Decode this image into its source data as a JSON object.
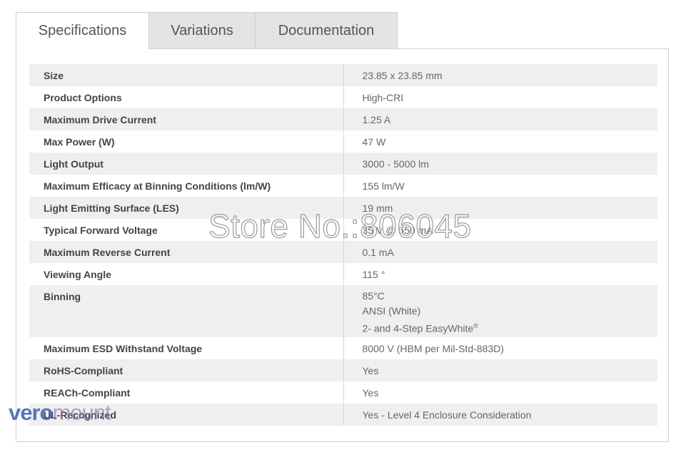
{
  "tabs": [
    {
      "label": "Specifications",
      "active": true
    },
    {
      "label": "Variations",
      "active": false
    },
    {
      "label": "Documentation",
      "active": false
    }
  ],
  "specs": [
    {
      "label": "Size",
      "value": "23.85 x 23.85 mm"
    },
    {
      "label": "Product Options",
      "value": "High-CRI"
    },
    {
      "label": "Maximum Drive Current",
      "value": "1.25 A"
    },
    {
      "label": "Max Power (W)",
      "value": "47 W"
    },
    {
      "label": "Light Output",
      "value": "3000 - 5000 lm"
    },
    {
      "label": "Maximum Efficacy at Binning Conditions (lm/W)",
      "value": "155 lm/W"
    },
    {
      "label": "Light Emitting Surface (LES)",
      "value": "19 mm"
    },
    {
      "label": "Typical Forward Voltage",
      "value": "35 V @ 550 mA"
    },
    {
      "label": "Maximum Reverse Current",
      "value": "0.1 mA"
    },
    {
      "label": "Viewing Angle",
      "value": "115 °"
    },
    {
      "label": "Binning",
      "values": [
        "85°C",
        "ANSI (White)",
        "2- and 4-Step EasyWhite"
      ],
      "trademark": "®"
    },
    {
      "label": "Maximum ESD Withstand Voltage",
      "value": "8000 V (HBM per Mil-Std-883D)"
    },
    {
      "label": "RoHS-Compliant",
      "value": "Yes"
    },
    {
      "label": "REACh-Compliant",
      "value": "Yes"
    },
    {
      "label": "UL-Recognized",
      "value": "Yes - Level 4 Enclosure Consideration"
    }
  ],
  "watermark": "Store No.:806045",
  "logo": {
    "part1": "vero",
    "part2": "mount"
  }
}
